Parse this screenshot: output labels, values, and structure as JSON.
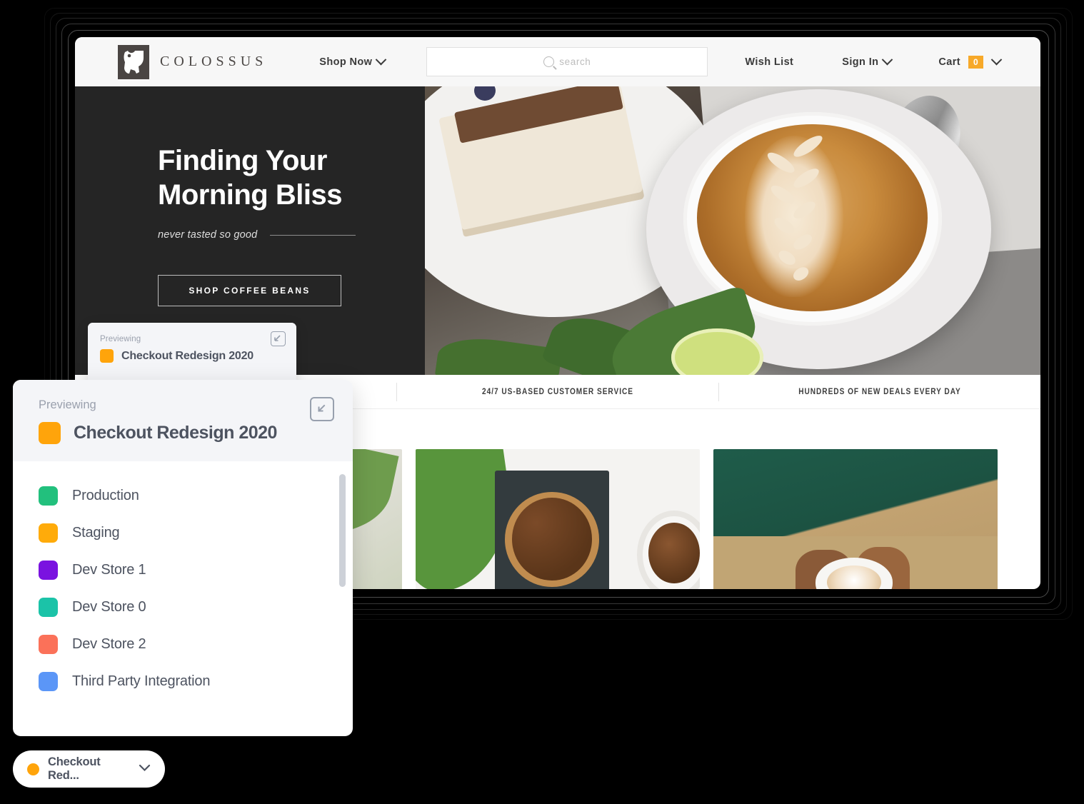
{
  "site": {
    "brand_name": "COLOSSUS",
    "logo_icon": "bison-logo-icon",
    "nav": {
      "shop_now": "Shop Now",
      "wish_list": "Wish List",
      "sign_in": "Sign In",
      "cart": "Cart",
      "cart_count": "0"
    },
    "search": {
      "placeholder": "search",
      "value": "",
      "icon": "search-icon"
    },
    "hero": {
      "title_line1": "Finding Your",
      "title_line2": "Morning Bliss",
      "subtitle": "never tasted so good",
      "cta": "SHOP COFFEE BEANS"
    },
    "promo": [
      "",
      "24/7 US-BASED CUSTOMER SERVICE",
      "HUNDREDS OF NEW DEALS EVERY DAY"
    ],
    "cards": [
      "coffee-plate-card",
      "coffee-beans-bowl-card",
      "person-holding-latte-card"
    ]
  },
  "preview_popup": {
    "label": "Previewing",
    "title": "Checkout Redesign 2020",
    "swatch_color": "#FFA40B",
    "expand_icon": "expand-collapse-icon",
    "environments": [
      {
        "label": "Production",
        "color": "#22C07D"
      },
      {
        "label": "Staging",
        "color": "#FFAB0A"
      },
      {
        "label": "Dev Store 1",
        "color": "#7A12E0"
      },
      {
        "label": "Dev Store 0",
        "color": "#1BC3A8"
      },
      {
        "label": "Dev Store 2",
        "color": "#FB7159"
      },
      {
        "label": "Third Party Integration",
        "color": "#5B96F7"
      }
    ]
  },
  "preview_popup_background": {
    "label": "Previewing",
    "title": "Checkout Redesign 2020",
    "swatch_color": "#FFA40B",
    "expand_icon": "expand-collapse-icon"
  },
  "pill": {
    "label": "Checkout Red...",
    "dot_color": "#FFA40B",
    "chevron_icon": "chevron-down-icon"
  }
}
